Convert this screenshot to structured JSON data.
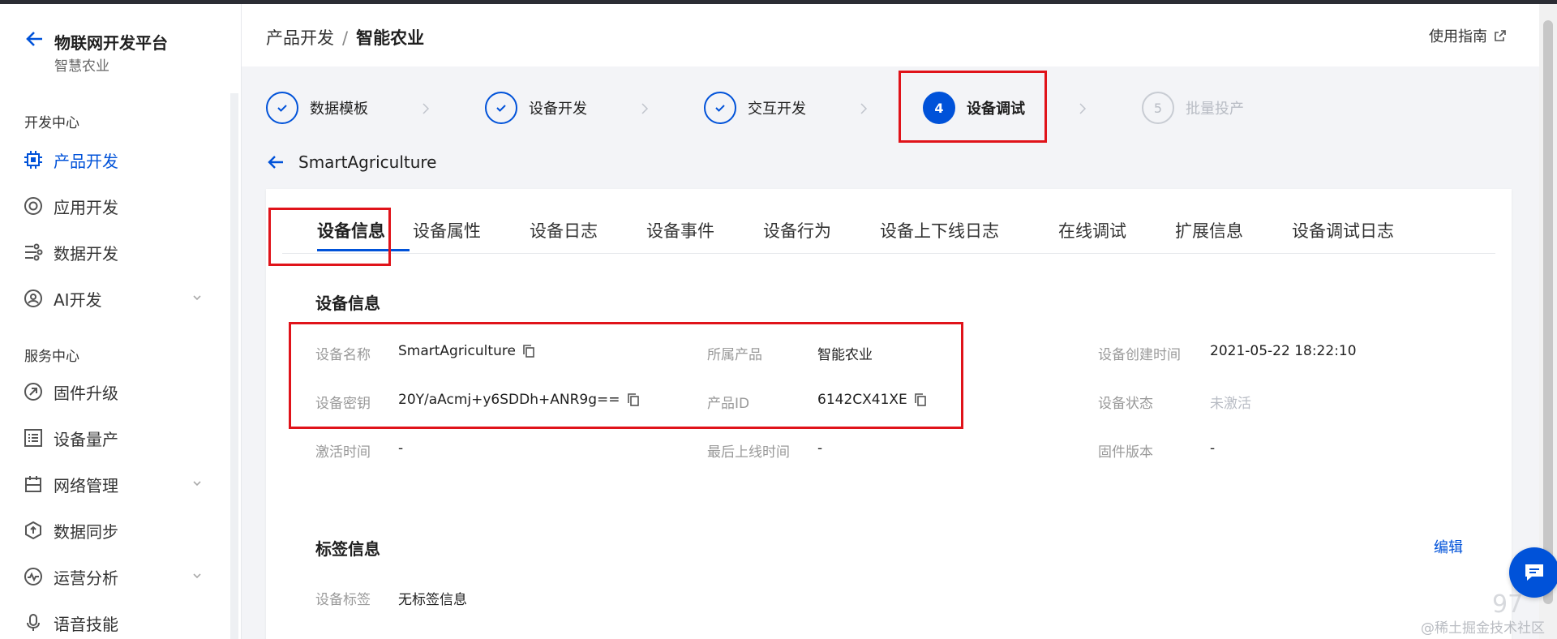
{
  "sidebar": {
    "title": "物联网开发平台",
    "subtitle": "智慧农业",
    "sections": [
      {
        "title": "开发中心"
      },
      {
        "title": "服务中心"
      }
    ],
    "items": [
      {
        "label": "产品开发",
        "icon": "chip-icon"
      },
      {
        "label": "应用开发",
        "icon": "app-icon"
      },
      {
        "label": "数据开发",
        "icon": "data-flow-icon"
      },
      {
        "label": "AI开发",
        "icon": "ai-icon"
      },
      {
        "label": "固件升级",
        "icon": "firmware-icon"
      },
      {
        "label": "设备量产",
        "icon": "list-icon"
      },
      {
        "label": "网络管理",
        "icon": "network-icon"
      },
      {
        "label": "数据同步",
        "icon": "sync-icon"
      },
      {
        "label": "运营分析",
        "icon": "analytics-icon"
      },
      {
        "label": "语音技能",
        "icon": "mic-icon"
      }
    ]
  },
  "header": {
    "breadcrumb_parent": "产品开发",
    "breadcrumb_sep": "/",
    "breadcrumb_current": "智能农业",
    "guide_label": "使用指南"
  },
  "steps": [
    {
      "label": "数据模板",
      "state": "done"
    },
    {
      "label": "设备开发",
      "state": "done"
    },
    {
      "label": "交互开发",
      "state": "done"
    },
    {
      "label": "设备调试",
      "state": "current",
      "num": "4"
    },
    {
      "label": "批量投产",
      "state": "todo",
      "num": "5"
    }
  ],
  "device_name_header": "SmartAgriculture",
  "tabs": [
    "设备信息",
    "设备属性",
    "设备日志",
    "设备事件",
    "设备行为",
    "设备上下线日志",
    "在线调试",
    "扩展信息",
    "设备调试日志"
  ],
  "device_info": {
    "title": "设备信息",
    "fields": {
      "name_label": "设备名称",
      "name_value": "SmartAgriculture",
      "product_label": "所属产品",
      "product_value": "智能农业",
      "created_label": "设备创建时间",
      "created_value": "2021-05-22 18:22:10",
      "secret_label": "设备密钥",
      "secret_value": "20Y/aAcmj+y6SDDh+ANR9g==",
      "pid_label": "产品ID",
      "pid_value": "6142CX41XE",
      "status_label": "设备状态",
      "status_value": "未激活",
      "activated_label": "激活时间",
      "activated_value": "-",
      "lastonline_label": "最后上线时间",
      "lastonline_value": "-",
      "firmware_label": "固件版本",
      "firmware_value": "-"
    }
  },
  "tag_info": {
    "title": "标签信息",
    "edit_label": "编辑",
    "tag_label": "设备标签",
    "tag_value": "无标签信息"
  },
  "watermark": "@稀土掘金技术社区",
  "watermark_num": "97",
  "colors": {
    "primary": "#0052d9",
    "highlight": "#e0131a"
  }
}
